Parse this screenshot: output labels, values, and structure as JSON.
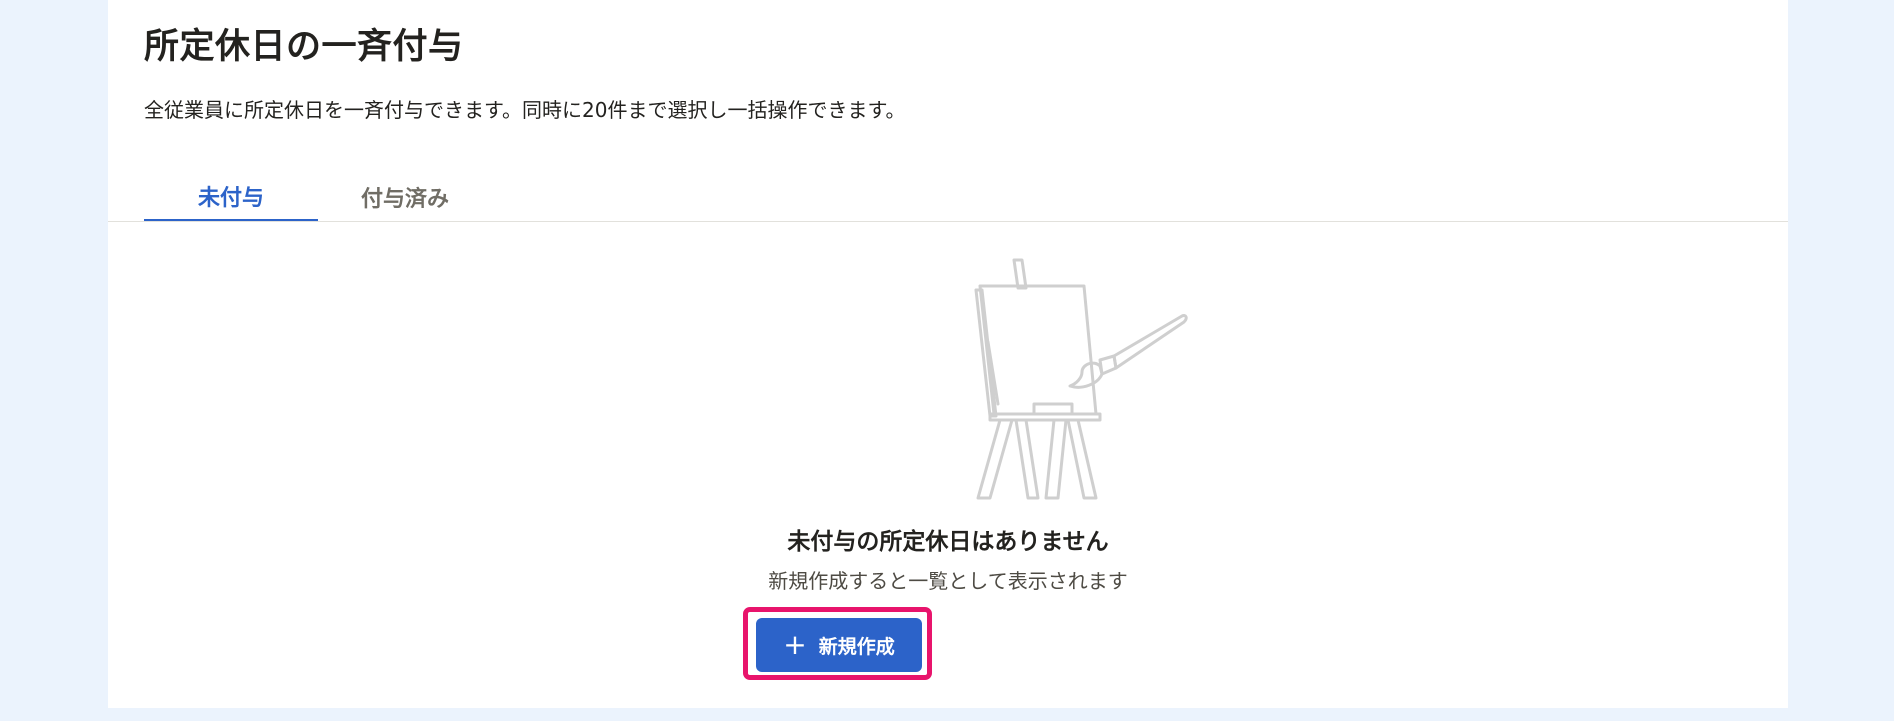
{
  "page": {
    "title": "所定休日の一斉付与",
    "description": "全従業員に所定休日を一斉付与できます。同時に20件まで選択し一括操作できます。"
  },
  "tabs": [
    {
      "label": "未付与",
      "active": true
    },
    {
      "label": "付与済み",
      "active": false
    }
  ],
  "empty_state": {
    "illustration_icon": "easel-paintbrush-icon",
    "title": "未付与の所定休日はありません",
    "description": "新規作成すると一覧として表示されます"
  },
  "actions": {
    "new_button_label": "新規作成",
    "new_button_icon": "plus-icon"
  },
  "colors": {
    "accent": "#2c63c9",
    "highlight": "#e8146c",
    "background": "#ebf3fd",
    "card": "#ffffff"
  }
}
